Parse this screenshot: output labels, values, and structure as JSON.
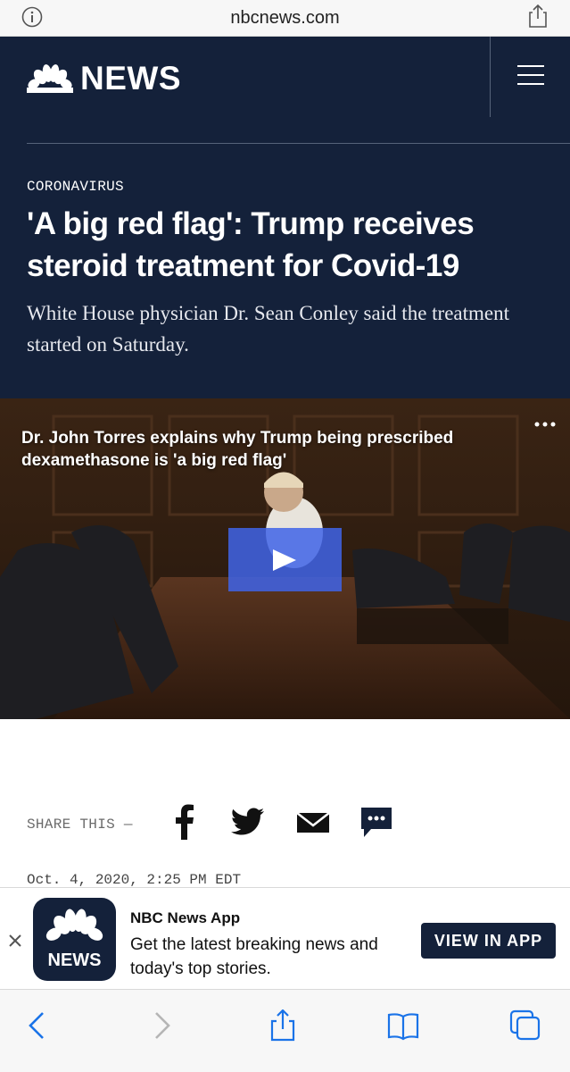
{
  "browser": {
    "url": "nbcnews.com",
    "info_icon": "info-icon",
    "share_icon": "share-icon"
  },
  "site": {
    "logo_text": "NEWS",
    "logo_icon": "peacock-icon",
    "menu_icon": "hamburger-menu-icon"
  },
  "article": {
    "category": "CORONAVIRUS",
    "headline": "'A big red flag': Trump receives steroid treatment for Covid-19",
    "dek": "White House physician Dr. Sean Conley said the treatment started on Saturday.",
    "video_title": "Dr. John Torres explains why Trump being prescribed dexamethasone is 'a big red flag'",
    "share_label": "SHARE THIS —",
    "date": "Oct. 4, 2020, 2:25 PM EDT"
  },
  "share_icons": [
    "facebook-icon",
    "twitter-icon",
    "email-icon",
    "sms-icon"
  ],
  "app_banner": {
    "icon_text": "NEWS",
    "app_name": "NBC News App",
    "description": "Get the latest breaking news and today's top stories.",
    "button_label": "VIEW IN APP"
  },
  "toolbar": {
    "icons": [
      "back-icon",
      "forward-icon",
      "share-icon",
      "bookmarks-icon",
      "tabs-icon"
    ]
  },
  "colors": {
    "header_bg": "#14213a",
    "play_button": "#4064e8",
    "toolbar_accent": "#1a73e8"
  }
}
